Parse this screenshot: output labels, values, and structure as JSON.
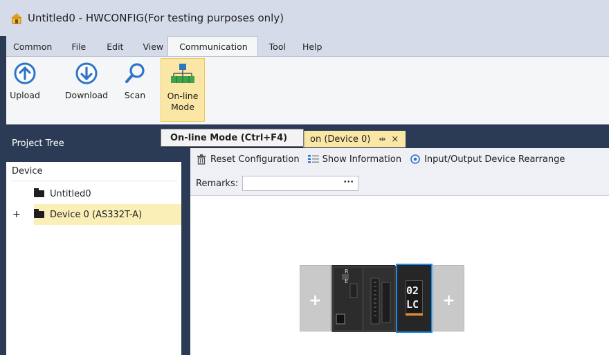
{
  "window": {
    "title": "Untitled0 - HWCONFIG(For testing purposes only)"
  },
  "ribbon": {
    "tabs": [
      {
        "label": "Common"
      },
      {
        "label": "File"
      },
      {
        "label": "Edit"
      },
      {
        "label": "View"
      },
      {
        "label": "Communication"
      },
      {
        "label": "Tool"
      },
      {
        "label": "Help"
      }
    ],
    "active_tab": "Communication",
    "buttons": {
      "upload": "Upload",
      "download": "Download",
      "scan": "Scan",
      "online_line1": "On-line",
      "online_line2": "Mode"
    }
  },
  "tooltip": {
    "text": "On-line Mode (Ctrl+F4)"
  },
  "project_tree": {
    "title": "Project Tree",
    "section_label": "Device",
    "items": [
      {
        "label": "Untitled0",
        "expander": ""
      },
      {
        "label": "Device 0 (AS332T-A)",
        "expander": "+"
      }
    ]
  },
  "document": {
    "tab_visible_text": "on (Device 0)",
    "pin_glyph": "⇹",
    "close_glyph": "×",
    "toolbar": {
      "reset": "Reset Configuration",
      "show_info": "Show Information",
      "rearrange": "Input/Output Device Rearrange"
    },
    "remarks_label": "Remarks:",
    "remarks_value": "",
    "remarks_button": "···"
  },
  "hardware": {
    "slot_plus": "+",
    "cpu_labels": [
      "R",
      "E"
    ],
    "io_module_label_1": "02",
    "io_module_label_2": "LC"
  },
  "colors": {
    "accent_blue": "#1e88e5",
    "panel_dark": "#2b3b55",
    "highlight_yellow": "#fbe7a5"
  }
}
